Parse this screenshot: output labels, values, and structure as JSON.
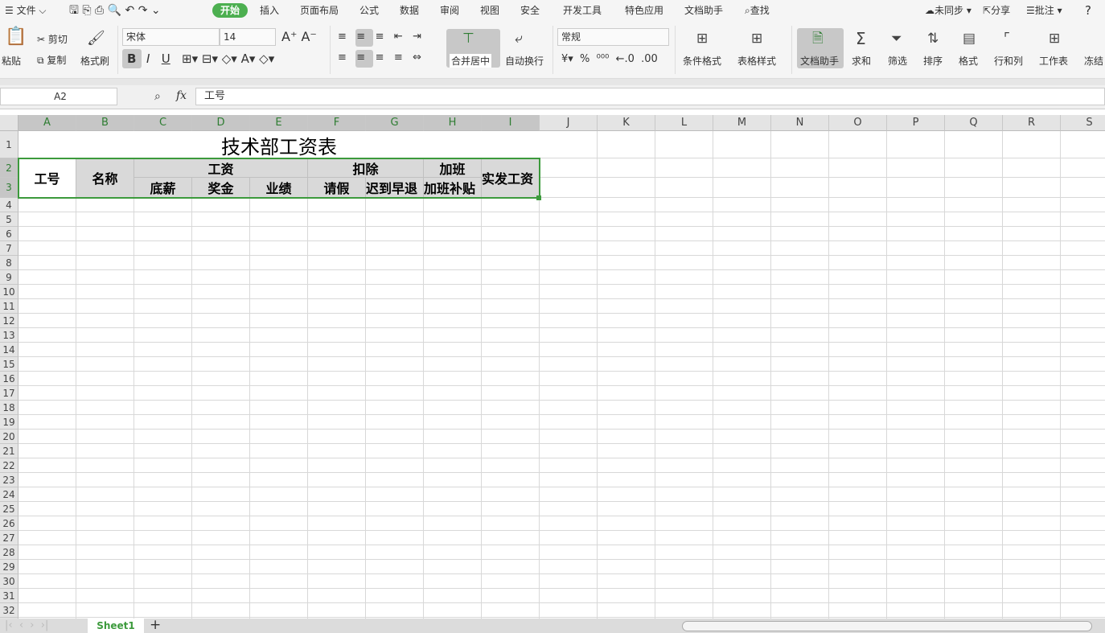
{
  "menu": {
    "file": "文件",
    "tabs": [
      "开始",
      "插入",
      "页面布局",
      "公式",
      "数据",
      "审阅",
      "视图",
      "安全",
      "开发工具",
      "特色应用",
      "文档助手"
    ],
    "search": "查找",
    "sync": "未同步",
    "share": "分享",
    "comment": "批注",
    "help": "?"
  },
  "ribbon": {
    "paste": "粘贴",
    "cut": "剪切",
    "copy": "复制",
    "format_painter": "格式刷",
    "font": "宋体",
    "font_size": "14",
    "merge": "合并居中",
    "wrap": "自动换行",
    "number_format": "常规",
    "cond_format": "条件格式",
    "table_style": "表格样式",
    "doc_helper": "文档助手",
    "sum": "求和",
    "filter": "筛选",
    "sort": "排序",
    "format": "格式",
    "rows_cols": "行和列",
    "worksheet": "工作表",
    "freeze": "冻结"
  },
  "formula_bar": {
    "name_box": "A2",
    "fx": "fx",
    "value": "工号"
  },
  "columns": [
    "A",
    "B",
    "C",
    "D",
    "E",
    "F",
    "G",
    "H",
    "I",
    "J",
    "K",
    "L",
    "M",
    "N",
    "O",
    "P",
    "Q",
    "R",
    "S"
  ],
  "sheet": {
    "title": "技术部工资表",
    "headers": {
      "id": "工号",
      "name": "名称",
      "salary": "工资",
      "deduct": "扣除",
      "overtime": "加班",
      "net": "实发工资",
      "base": "底薪",
      "bonus": "奖金",
      "perf": "业绩",
      "leave": "请假",
      "late": "迟到早退",
      "ot_pay": "加班补贴"
    }
  },
  "tabs": {
    "sheet1": "Sheet1",
    "add": "+"
  },
  "colors": {
    "accent": "#4caf50",
    "selection": "#3c9a3c"
  }
}
